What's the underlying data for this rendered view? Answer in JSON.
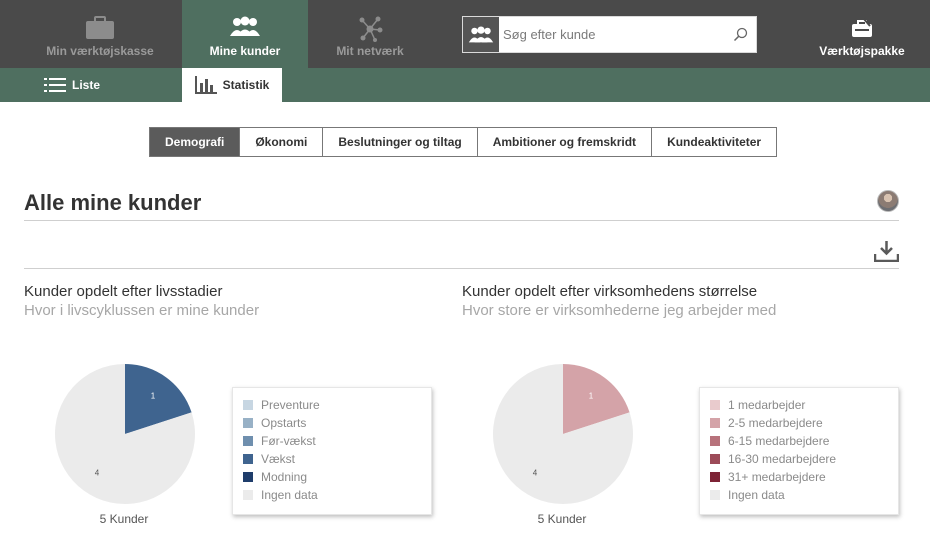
{
  "topnav": {
    "items": [
      {
        "label": "Min værktøjskasse",
        "icon": "briefcase-icon"
      },
      {
        "label": "Mine kunder",
        "icon": "customers-icon"
      },
      {
        "label": "Mit netværk",
        "icon": "network-icon"
      }
    ],
    "search_placeholder": "Søg efter kunde",
    "toolkit_label": "Værktøjspakke"
  },
  "subnav": {
    "list_label": "Liste",
    "stats_label": "Statistik"
  },
  "segments": [
    "Demografi",
    "Økonomi",
    "Beslutninger og tiltag",
    "Ambitioner og fremskridt",
    "Kundeaktiviteter"
  ],
  "page": {
    "title": "Alle mine kunder"
  },
  "charts": [
    {
      "title": "Kunder opdelt efter livsstadier",
      "subtitle": "Hvor i livscyklussen er mine kunder",
      "caption": "5 Kunder",
      "slices": [
        {
          "label": "Vækst",
          "value": 1,
          "color": "#3f648f"
        },
        {
          "label": "Ingen data",
          "value": 4,
          "color": "#ebebeb"
        }
      ],
      "legend": [
        {
          "label": "Preventure",
          "color": "#c7d6e2"
        },
        {
          "label": "Opstarts",
          "color": "#98b1c6"
        },
        {
          "label": "Før-vækst",
          "color": "#6f8fae"
        },
        {
          "label": "Vækst",
          "color": "#3f648f"
        },
        {
          "label": "Modning",
          "color": "#1f3d6b"
        },
        {
          "label": "Ingen data",
          "color": "#ebebeb"
        }
      ]
    },
    {
      "title": "Kunder opdelt efter virksomhedens størrelse",
      "subtitle": "Hvor store er virksomhederne jeg arbejder med",
      "caption": "5 Kunder",
      "slices": [
        {
          "label": "2-5 medarbejdere",
          "value": 1,
          "color": "#d4a3a8"
        },
        {
          "label": "Ingen data",
          "value": 4,
          "color": "#ebebeb"
        }
      ],
      "legend": [
        {
          "label": "1 medarbejder",
          "color": "#e9cbcd"
        },
        {
          "label": "2-5 medarbejdere",
          "color": "#d4a3a8"
        },
        {
          "label": "6-15 medarbejdere",
          "color": "#b7727b"
        },
        {
          "label": "16-30 medarbejdere",
          "color": "#9c4b58"
        },
        {
          "label": "31+ medarbejdere",
          "color": "#7d2335"
        },
        {
          "label": "Ingen data",
          "color": "#ebebeb"
        }
      ]
    }
  ]
}
